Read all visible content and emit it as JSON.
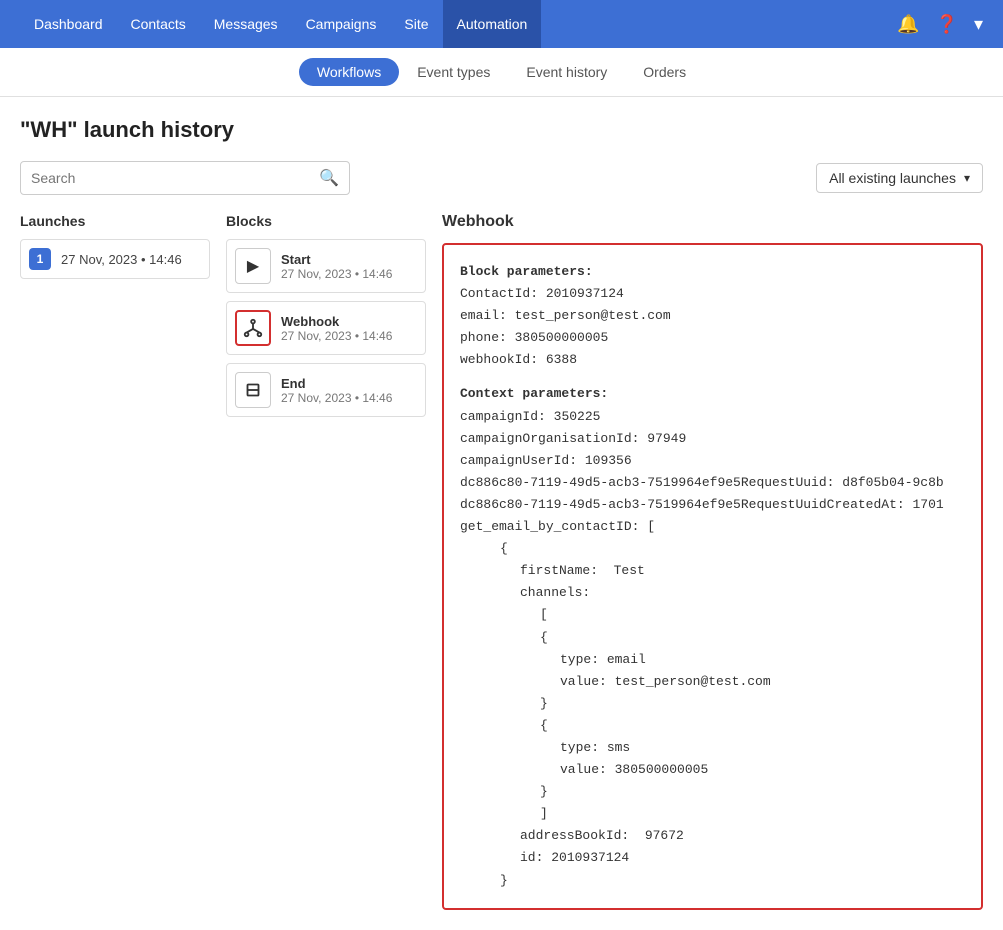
{
  "nav": {
    "items": [
      {
        "label": "Dashboard",
        "active": false
      },
      {
        "label": "Contacts",
        "active": false
      },
      {
        "label": "Messages",
        "active": false
      },
      {
        "label": "Campaigns",
        "active": false
      },
      {
        "label": "Site",
        "active": false
      },
      {
        "label": "Automation",
        "active": true
      }
    ]
  },
  "subnav": {
    "tabs": [
      {
        "label": "Workflows",
        "active": true
      },
      {
        "label": "Event types",
        "active": false
      },
      {
        "label": "Event history",
        "active": false
      },
      {
        "label": "Orders",
        "active": false
      }
    ]
  },
  "page": {
    "title": "\"WH\" launch history"
  },
  "toolbar": {
    "search_placeholder": "Search",
    "filter_label": "All existing launches"
  },
  "launches": {
    "panel_title": "Launches",
    "items": [
      {
        "number": "1",
        "date": "27 Nov, 2023 • 14:46"
      }
    ]
  },
  "blocks": {
    "panel_title": "Blocks",
    "items": [
      {
        "name": "Start",
        "date": "27 Nov, 2023 • 14:46",
        "icon": "▶",
        "selected": false
      },
      {
        "name": "Webhook",
        "date": "27 Nov, 2023 • 14:46",
        "icon": "webhook",
        "selected": true
      },
      {
        "name": "End",
        "date": "27 Nov, 2023 • 14:46",
        "icon": "end",
        "selected": false
      }
    ]
  },
  "webhook": {
    "panel_title": "Webhook",
    "block_params_label": "Block parameters:",
    "contact_id_label": "ContactId:",
    "contact_id_value": "2010937124",
    "email_label": "email:",
    "email_value": "test_person@test.com",
    "phone_label": "phone:",
    "phone_value": "380500000005",
    "webhook_id_label": "webhookId:",
    "webhook_id_value": "6388",
    "context_params_label": "Context parameters:",
    "campaign_id_label": "campaignId:",
    "campaign_id_value": "350225",
    "campaign_org_id_label": "campaignOrganisationId:",
    "campaign_org_id_value": "97949",
    "campaign_user_id_label": "campaignUserId:",
    "campaign_user_id_value": "109356",
    "request_uuid_label": "dc886c80-7119-49d5-acb3-7519964ef9e5RequestUuid:",
    "request_uuid_value": "d8f05b04-9c8b",
    "request_uuid_created_label": "dc886c80-7119-49d5-acb3-7519964ef9e5RequestUuidCreatedAt:",
    "request_uuid_created_value": "1701",
    "get_email_label": "get_email_by_contactID:",
    "open_bracket": "[",
    "open_brace": "{",
    "first_name_label": "firstName:",
    "first_name_value": "Test",
    "channels_label": "channels:",
    "channels_open": "[",
    "ch1_open": "{",
    "ch1_type_label": "type:",
    "ch1_type_value": "email",
    "ch1_value_label": "value:",
    "ch1_value": "test_person@test.com",
    "ch1_close": "}",
    "ch2_open": "{",
    "ch2_type_label": "type:",
    "ch2_type_value": "sms",
    "ch2_value_label": "value:",
    "ch2_value": "380500000005",
    "ch2_close": "}",
    "channels_close": "]",
    "address_book_id_label": "addressBookId:",
    "address_book_id_value": "97672",
    "id_label": "id:",
    "id_value": "2010937124",
    "obj_close": "}"
  }
}
